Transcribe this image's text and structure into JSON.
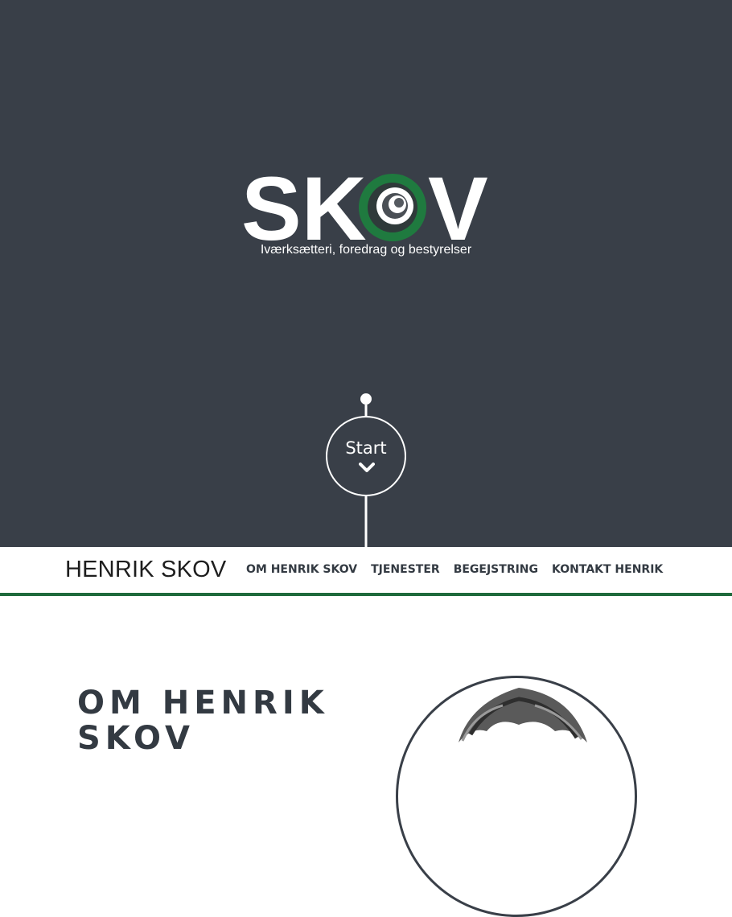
{
  "hero": {
    "logo_text": "SKOV",
    "tagline": "Iværksætteri, foredrag og bestyrelser",
    "start_label": "Start",
    "colors": {
      "background": "#393f48",
      "logo_green": "#1f7a3f",
      "text": "#ffffff"
    }
  },
  "nav": {
    "brand": "HENRIK SKOV",
    "links": [
      "OM HENRIK SKOV",
      "TJENESTER",
      "BEGEJSTRING",
      "KONTAKT HENRIK"
    ],
    "accent_color": "#1f6a3c"
  },
  "about": {
    "title": "OM HENRIK SKOV"
  }
}
